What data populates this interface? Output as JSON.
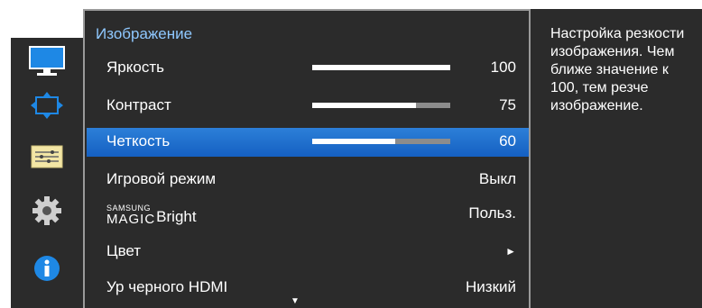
{
  "sidebar": {
    "items": [
      {
        "icon": "monitor-picture-icon",
        "selected": true
      },
      {
        "icon": "screen-size-icon",
        "selected": false
      },
      {
        "icon": "settings-sliders-icon",
        "selected": false
      },
      {
        "icon": "gear-icon",
        "selected": false
      },
      {
        "icon": "info-icon",
        "selected": false
      }
    ]
  },
  "menu": {
    "title": "Изображение",
    "items": [
      {
        "label": "Яркость",
        "value": "100",
        "level": 1.0
      },
      {
        "label": "Контраст",
        "value": "75",
        "level": 0.75
      },
      {
        "label": "Четкость",
        "value": "60",
        "level": 0.6,
        "selected": true
      },
      {
        "label": "Игровой режим",
        "value": "Выкл"
      },
      {
        "label_brand_small": "SAMSUNG",
        "label_brand_big": "MAGIC",
        "label": "Bright",
        "value": "Польз."
      },
      {
        "label": "Цвет",
        "value": "►"
      },
      {
        "label": "Ур черного HDMI",
        "value": "Низкий"
      }
    ],
    "scroll_indicator": "▼"
  },
  "help": {
    "text": "Настройка резкости изображения. Чем ближе значение к 100, тем резче изображение."
  },
  "colors": {
    "panel": "#2b2b2b",
    "selected": "#1c6dd0",
    "title": "#8fc8ff",
    "sidebar_selected": "#1e88e5"
  }
}
